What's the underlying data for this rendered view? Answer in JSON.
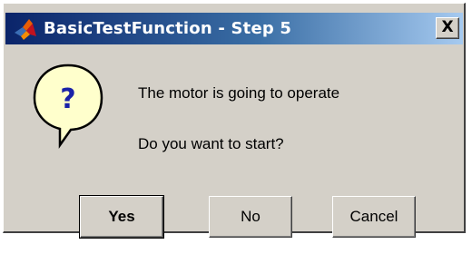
{
  "dialog": {
    "title": "BasicTestFunction - Step 5",
    "close_label": "X",
    "icon": "matlab-logo-icon",
    "question_icon": "question-icon",
    "question_mark": "?",
    "messages": [
      "The motor is going to operate",
      "Do you want to start?"
    ],
    "buttons": {
      "yes": "Yes",
      "no": "No",
      "cancel": "Cancel"
    },
    "colors": {
      "titlebar_start": "#0a246a",
      "titlebar_end": "#a6caf0",
      "face": "#d4d0c8",
      "bubble": "#ffffcc"
    }
  }
}
